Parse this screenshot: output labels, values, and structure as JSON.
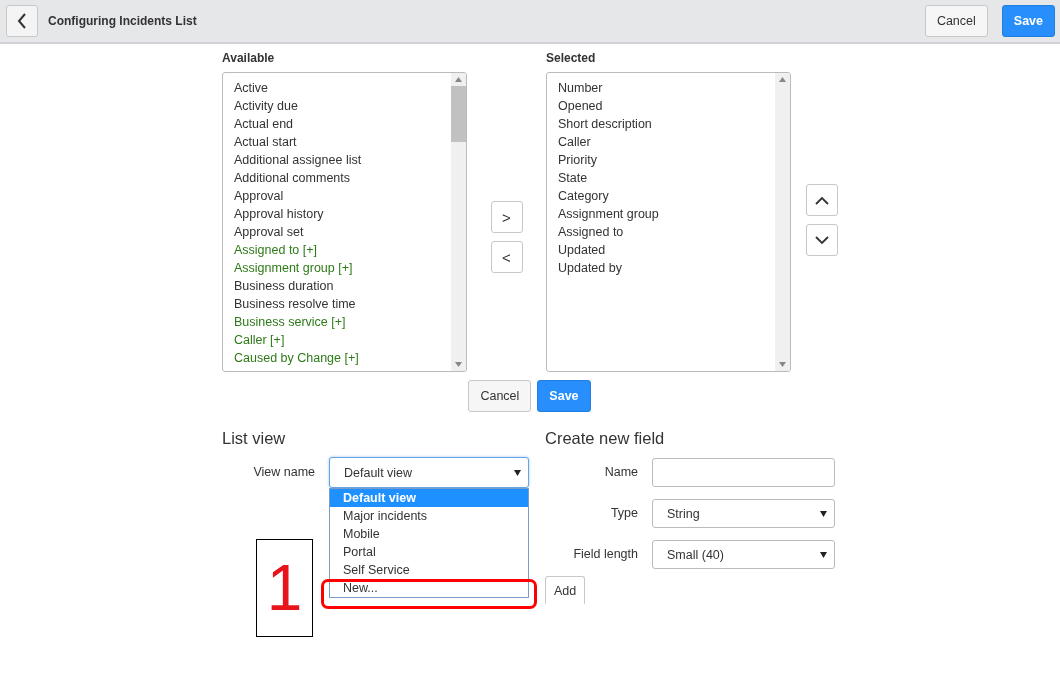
{
  "header": {
    "title": "Configuring Incidents List",
    "buttons": [
      {
        "label": "Cancel",
        "kind": "secondary"
      },
      {
        "label": "Save",
        "kind": "primary"
      }
    ]
  },
  "available": {
    "label": "Available",
    "items": [
      {
        "label": "Active",
        "kind": "field"
      },
      {
        "label": "Activity due",
        "kind": "field"
      },
      {
        "label": "Actual end",
        "kind": "field"
      },
      {
        "label": "Actual start",
        "kind": "field"
      },
      {
        "label": "Additional assignee list",
        "kind": "field"
      },
      {
        "label": "Additional comments",
        "kind": "field"
      },
      {
        "label": "Approval",
        "kind": "field"
      },
      {
        "label": "Approval history",
        "kind": "field"
      },
      {
        "label": "Approval set",
        "kind": "field"
      },
      {
        "label": "Assigned to [+]",
        "kind": "reference"
      },
      {
        "label": "Assignment group [+]",
        "kind": "reference"
      },
      {
        "label": "Business duration",
        "kind": "field"
      },
      {
        "label": "Business resolve time",
        "kind": "field"
      },
      {
        "label": "Business service [+]",
        "kind": "reference"
      },
      {
        "label": "Caller [+]",
        "kind": "reference"
      },
      {
        "label": "Caused by Change [+]",
        "kind": "reference"
      }
    ]
  },
  "move_buttons": [
    {
      "label": ">"
    },
    {
      "label": "<"
    }
  ],
  "selected": {
    "label": "Selected",
    "items": [
      "Number",
      "Opened",
      "Short description",
      "Caller",
      "Priority",
      "State",
      "Category",
      "Assignment group",
      "Assigned to",
      "Updated",
      "Updated by"
    ]
  },
  "order_buttons": [
    {
      "kind": "up"
    },
    {
      "kind": "down"
    }
  ],
  "form_buttons": [
    {
      "label": "Cancel",
      "kind": "secondary"
    },
    {
      "label": "Save",
      "kind": "primary"
    }
  ],
  "list_view": {
    "title": "List view",
    "view_name_label": "View name",
    "view_name_value": "Default view",
    "dropdown_open": true,
    "options": [
      {
        "label": "Default view",
        "selected": true
      },
      {
        "label": "Major incidents",
        "selected": false
      },
      {
        "label": "Mobile",
        "selected": false
      },
      {
        "label": "Portal",
        "selected": false
      },
      {
        "label": "Self Service",
        "selected": false
      },
      {
        "label": "New...",
        "selected": false
      }
    ]
  },
  "create_field": {
    "title": "Create new field",
    "fields": [
      {
        "label": "Name",
        "kind": "text"
      },
      {
        "label": "Type",
        "kind": "select",
        "value": "String"
      },
      {
        "label": "Field length",
        "kind": "select",
        "value": "Small (40)"
      }
    ],
    "add_button": "Add"
  },
  "callout": {
    "number": "1"
  }
}
